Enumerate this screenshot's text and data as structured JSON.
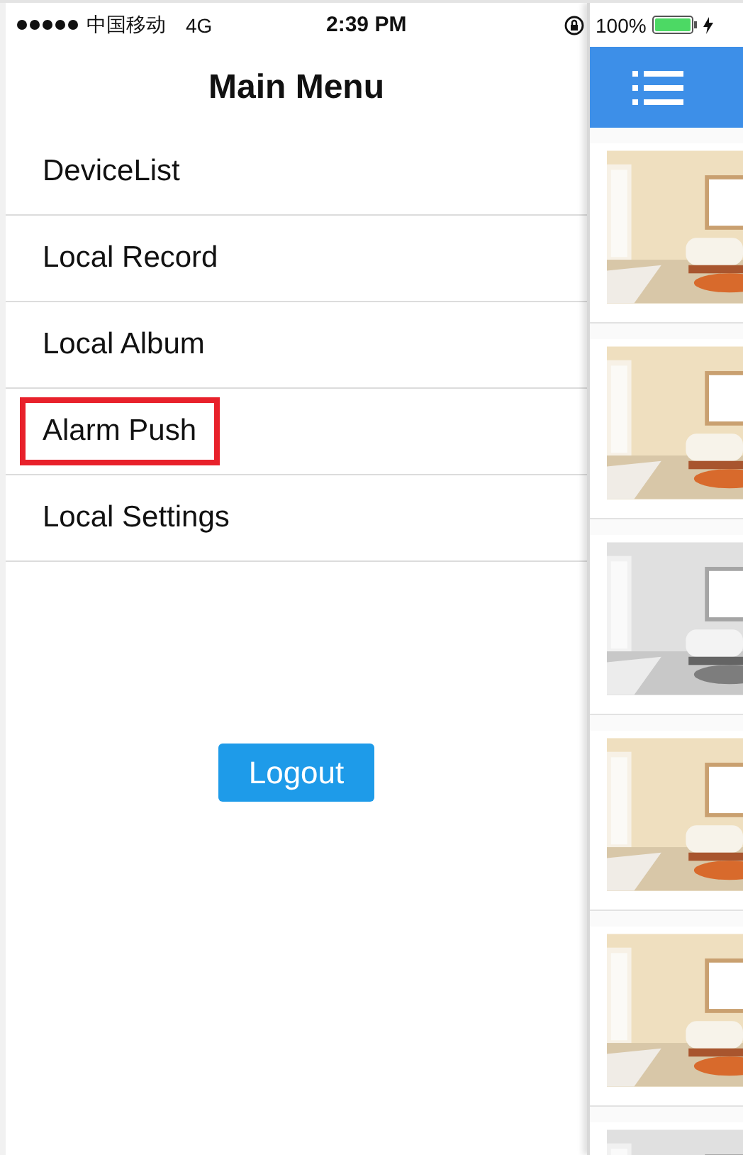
{
  "status_bar": {
    "carrier": "中国移动",
    "network": "4G",
    "time": "2:39 PM",
    "battery": "100%"
  },
  "menu": {
    "title": "Main Menu",
    "items": [
      {
        "label": "DeviceList",
        "highlighted": false
      },
      {
        "label": "Local Record",
        "highlighted": false
      },
      {
        "label": "Local Album",
        "highlighted": false
      },
      {
        "label": "Alarm Push",
        "highlighted": true
      },
      {
        "label": "Local Settings",
        "highlighted": false
      }
    ],
    "logout": "Logout"
  },
  "side_panel": {
    "thumbnails": [
      {
        "grayscale": false
      },
      {
        "grayscale": false
      },
      {
        "grayscale": true
      },
      {
        "grayscale": false
      },
      {
        "grayscale": false
      },
      {
        "grayscale": true
      }
    ]
  }
}
